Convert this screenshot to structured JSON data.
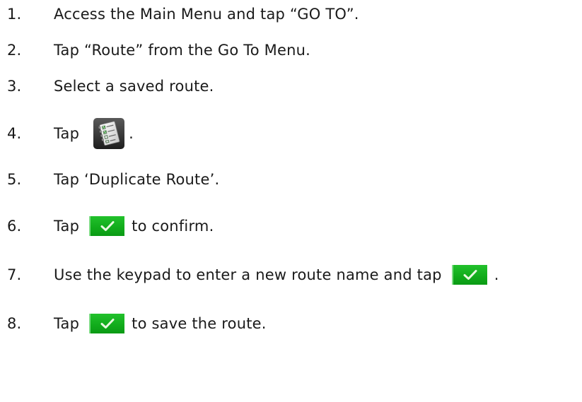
{
  "steps": [
    {
      "num": "1.",
      "text": "Access the Main Menu and tap “GO TO”."
    },
    {
      "num": "2.",
      "text": "Tap “Route” from the Go To Menu."
    },
    {
      "num": "3.",
      "text": "Select a saved route."
    },
    {
      "num": "4.",
      "before": "Tap",
      "icon": "route-options-menu-icon",
      "after": "."
    },
    {
      "num": "5.",
      "text": "Tap ‘Duplicate Route’."
    },
    {
      "num": "6.",
      "before": "Tap",
      "icon": "green-checkmark-button",
      "after": "to confirm."
    },
    {
      "num": "7.",
      "before": "Use the keypad to enter a new route name and tap",
      "icon": "green-checkmark-button",
      "after": "."
    },
    {
      "num": "8.",
      "before": "Tap",
      "icon": "green-checkmark-button",
      "after": "to save the route."
    }
  ],
  "colors": {
    "text": "#1a1a1a",
    "check_button": "#16b31f",
    "check_mark": "#e8f8e0"
  }
}
